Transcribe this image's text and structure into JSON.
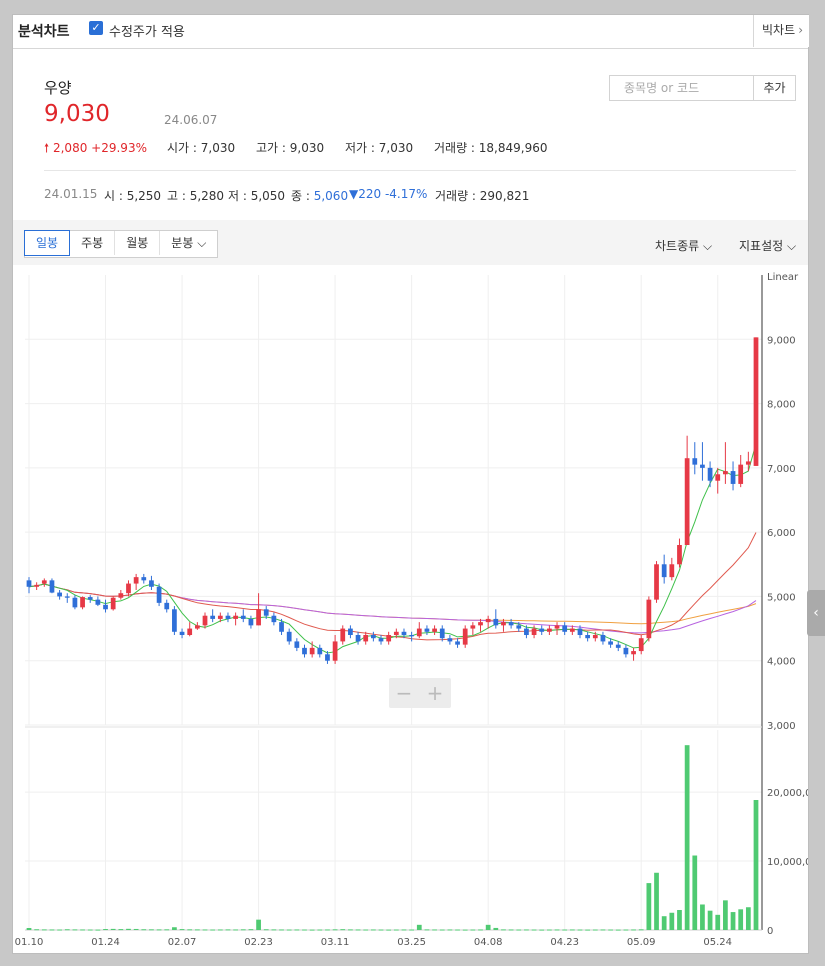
{
  "header": {
    "title": "분석차트",
    "adjusted_label": "수정주가 적용",
    "big_chart": "빅차트",
    "search_placeholder": "종목명 or 코드",
    "add_button": "추가"
  },
  "stock": {
    "name": "우양",
    "price": "9,030",
    "date": "24.06.07",
    "change": "2,080",
    "change_pct": "+29.93%",
    "open_label": "시가 : 7,030",
    "high_label": "고가 : 9,030",
    "low_label": "저가 : 7,030",
    "volume_label": "거래량 : 18,849,960"
  },
  "hover": {
    "date": "24.01.15",
    "open": "시 : 5,250",
    "high": "고 : 5,280",
    "low": "저 : 5,050",
    "close_label": "종 : ",
    "close_value": "5,060",
    "change": "220",
    "change_pct": "-4.17%",
    "volume": "거래량 : 290,821"
  },
  "tabs": [
    "일봉",
    "주봉",
    "월봉",
    "분봉"
  ],
  "menus": {
    "chart_type": "차트종류",
    "indicator": "지표설정"
  },
  "colors": {
    "up": "#e63946",
    "down": "#2f6fd8",
    "ma5": "#3fc04a",
    "ma20": "#e05a4f",
    "ma60": "#b763e0",
    "ma120": "#f0a040",
    "volume": "#4fca72"
  },
  "chart_data": {
    "type": "candlestick",
    "scale": "Linear",
    "price_ticks": [
      "9,000",
      "8,000",
      "7,000",
      "6,000",
      "5,000",
      "4,000",
      "3,000"
    ],
    "price_tick_values": [
      9000,
      8000,
      7000,
      6000,
      5000,
      4000,
      3000
    ],
    "ylim": [
      3000,
      10000
    ],
    "volume_ticks": [
      "20,000,000",
      "10,000,000",
      "0"
    ],
    "volume_tick_values": [
      20000000,
      10000000,
      0
    ],
    "volume_ylim": [
      0,
      29000000
    ],
    "x_labels": [
      "01.10",
      "01.24",
      "02.07",
      "02.23",
      "03.11",
      "03.25",
      "04.08",
      "04.23",
      "05.09",
      "05.24"
    ],
    "x_label_index": [
      0,
      10,
      20,
      30,
      40,
      50,
      60,
      70,
      80,
      90
    ],
    "candles": [
      [
        5250,
        5300,
        5050,
        5150
      ],
      [
        5150,
        5220,
        5100,
        5180
      ],
      [
        5200,
        5280,
        5150,
        5250
      ],
      [
        5250,
        5280,
        5050,
        5060
      ],
      [
        5060,
        5100,
        4950,
        5000
      ],
      [
        5000,
        5050,
        4900,
        4980
      ],
      [
        4980,
        5020,
        4800,
        4830
      ],
      [
        4830,
        5000,
        4800,
        4990
      ],
      [
        4990,
        5020,
        4900,
        4950
      ],
      [
        4950,
        5000,
        4850,
        4870
      ],
      [
        4870,
        4950,
        4750,
        4800
      ],
      [
        4800,
        5000,
        4780,
        4980
      ],
      [
        4980,
        5100,
        4950,
        5050
      ],
      [
        5050,
        5250,
        5000,
        5200
      ],
      [
        5200,
        5350,
        5100,
        5300
      ],
      [
        5300,
        5350,
        5200,
        5250
      ],
      [
        5250,
        5320,
        5100,
        5150
      ],
      [
        5150,
        5200,
        4850,
        4900
      ],
      [
        4900,
        4950,
        4750,
        4800
      ],
      [
        4800,
        4850,
        4400,
        4450
      ],
      [
        4450,
        4500,
        4350,
        4400
      ],
      [
        4400,
        4600,
        4380,
        4500
      ],
      [
        4500,
        4600,
        4480,
        4550
      ],
      [
        4550,
        4750,
        4500,
        4700
      ],
      [
        4700,
        4800,
        4600,
        4650
      ],
      [
        4650,
        4750,
        4600,
        4700
      ],
      [
        4700,
        4750,
        4600,
        4650
      ],
      [
        4650,
        4750,
        4550,
        4700
      ],
      [
        4700,
        4800,
        4600,
        4650
      ],
      [
        4650,
        4700,
        4500,
        4550
      ],
      [
        4550,
        5050,
        4550,
        4800
      ],
      [
        4800,
        4850,
        4650,
        4700
      ],
      [
        4700,
        4750,
        4550,
        4600
      ],
      [
        4600,
        4650,
        4400,
        4450
      ],
      [
        4450,
        4500,
        4250,
        4300
      ],
      [
        4300,
        4350,
        4150,
        4200
      ],
      [
        4200,
        4250,
        4050,
        4100
      ],
      [
        4100,
        4300,
        4050,
        4200
      ],
      [
        4200,
        4250,
        4050,
        4100
      ],
      [
        4100,
        4150,
        3950,
        4000
      ],
      [
        4000,
        4400,
        3950,
        4300
      ],
      [
        4300,
        4550,
        4250,
        4500
      ],
      [
        4500,
        4550,
        4350,
        4400
      ],
      [
        4400,
        4450,
        4250,
        4300
      ],
      [
        4300,
        4450,
        4250,
        4400
      ],
      [
        4400,
        4450,
        4300,
        4350
      ],
      [
        4350,
        4400,
        4250,
        4300
      ],
      [
        4300,
        4450,
        4250,
        4400
      ],
      [
        4400,
        4500,
        4350,
        4450
      ],
      [
        4450,
        4500,
        4350,
        4400
      ],
      [
        4400,
        4450,
        4300,
        4380
      ],
      [
        4380,
        4600,
        4350,
        4500
      ],
      [
        4500,
        4550,
        4400,
        4450
      ],
      [
        4450,
        4550,
        4400,
        4500
      ],
      [
        4500,
        4550,
        4300,
        4350
      ],
      [
        4350,
        4400,
        4250,
        4300
      ],
      [
        4300,
        4350,
        4200,
        4250
      ],
      [
        4250,
        4550,
        4200,
        4500
      ],
      [
        4500,
        4600,
        4400,
        4550
      ],
      [
        4550,
        4650,
        4450,
        4600
      ],
      [
        4600,
        4700,
        4500,
        4650
      ],
      [
        4650,
        4800,
        4500,
        4550
      ],
      [
        4550,
        4650,
        4450,
        4600
      ],
      [
        4600,
        4650,
        4500,
        4550
      ],
      [
        4550,
        4600,
        4450,
        4500
      ],
      [
        4500,
        4550,
        4350,
        4400
      ],
      [
        4400,
        4550,
        4350,
        4500
      ],
      [
        4500,
        4550,
        4400,
        4450
      ],
      [
        4450,
        4550,
        4400,
        4500
      ],
      [
        4500,
        4600,
        4400,
        4550
      ],
      [
        4550,
        4600,
        4400,
        4450
      ],
      [
        4450,
        4550,
        4400,
        4500
      ],
      [
        4500,
        4550,
        4350,
        4400
      ],
      [
        4400,
        4450,
        4300,
        4350
      ],
      [
        4350,
        4450,
        4300,
        4400
      ],
      [
        4400,
        4450,
        4250,
        4300
      ],
      [
        4300,
        4350,
        4200,
        4250
      ],
      [
        4250,
        4300,
        4150,
        4200
      ],
      [
        4200,
        4250,
        4050,
        4100
      ],
      [
        4100,
        4200,
        4000,
        4150
      ],
      [
        4150,
        4400,
        4100,
        4350
      ],
      [
        4350,
        5000,
        4300,
        4950
      ],
      [
        4950,
        5550,
        4900,
        5500
      ],
      [
        5500,
        5650,
        5200,
        5300
      ],
      [
        5300,
        5600,
        5250,
        5500
      ],
      [
        5500,
        5900,
        5450,
        5800
      ],
      [
        5800,
        7500,
        5800,
        7150
      ],
      [
        7150,
        7400,
        6900,
        7050
      ],
      [
        7050,
        7400,
        6800,
        7000
      ],
      [
        7000,
        7100,
        6700,
        6800
      ],
      [
        6800,
        7000,
        6600,
        6900
      ],
      [
        6900,
        7400,
        6750,
        6950
      ],
      [
        6950,
        7100,
        6650,
        6750
      ],
      [
        6750,
        7200,
        6700,
        7050
      ],
      [
        7050,
        7250,
        6950,
        7100
      ],
      [
        7030,
        9030,
        7030,
        9030
      ]
    ],
    "volumes": [
      290821,
      110000,
      90000,
      80000,
      70000,
      110000,
      90000,
      80000,
      70000,
      60000,
      140000,
      160000,
      130000,
      170000,
      150000,
      110000,
      100000,
      90000,
      100000,
      400000,
      130000,
      100000,
      90000,
      80000,
      70000,
      80000,
      90000,
      80000,
      100000,
      120000,
      1500000,
      110000,
      90000,
      80000,
      70000,
      80000,
      70000,
      60000,
      70000,
      80000,
      100000,
      120000,
      90000,
      80000,
      70000,
      80000,
      70000,
      60000,
      70000,
      80000,
      70000,
      750000,
      90000,
      80000,
      70000,
      80000,
      70000,
      60000,
      70000,
      80000,
      750000,
      300000,
      90000,
      80000,
      70000,
      80000,
      70000,
      60000,
      70000,
      80000,
      70000,
      80000,
      70000,
      60000,
      70000,
      80000,
      70000,
      60000,
      70000,
      80000,
      100000,
      6800000,
      8300000,
      2000000,
      2500000,
      2900000,
      26800000,
      10800000,
      3700000,
      2800000,
      2200000,
      4300000,
      2600000,
      3000000,
      3300000,
      18849960
    ]
  }
}
